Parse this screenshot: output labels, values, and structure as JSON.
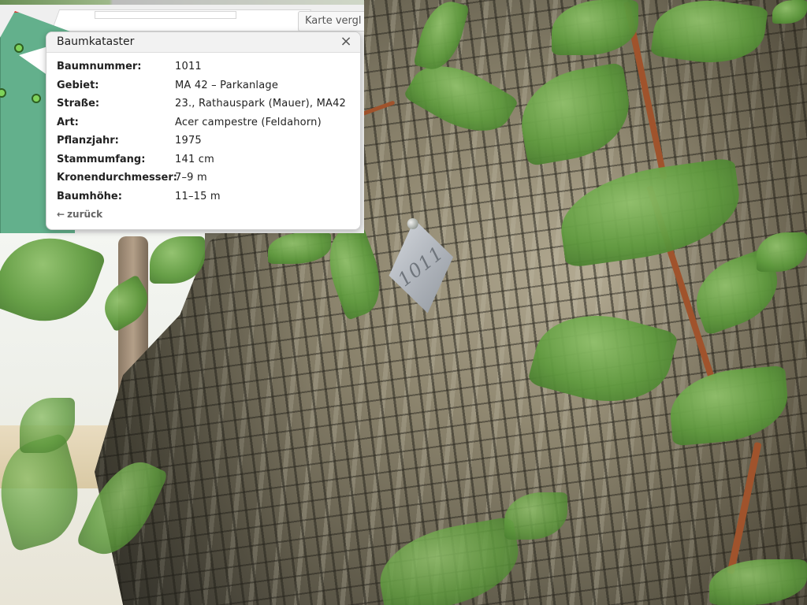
{
  "map": {
    "compare_label": "Karte vergl"
  },
  "popup": {
    "title": "Baumkataster",
    "close_icon": "×",
    "rows": [
      {
        "label": "Baumnummer:",
        "value": "1011"
      },
      {
        "label": "Gebiet:",
        "value": "MA 42 – Parkanlage"
      },
      {
        "label": "Straße:",
        "value": "23., Rathauspark (Mauer), MA42"
      },
      {
        "label": "Art:",
        "value": "Acer campestre (Feldahorn)"
      },
      {
        "label": "Pflanzjahr:",
        "value": "1975"
      },
      {
        "label": "Stammumfang:",
        "value": "141 cm"
      },
      {
        "label": "Kronendurchmesser:",
        "value": "7–9 m"
      },
      {
        "label": "Baumhöhe:",
        "value": "11–15 m"
      }
    ],
    "back_arrow": "←",
    "back_label": "zurück"
  },
  "photo": {
    "tag_number": "1011"
  },
  "colors": {
    "park": "#63b08c",
    "park_border": "#e53935",
    "marker": "#7fd35a"
  },
  "icons": {
    "close": "close-icon",
    "back": "arrow-left-icon"
  }
}
